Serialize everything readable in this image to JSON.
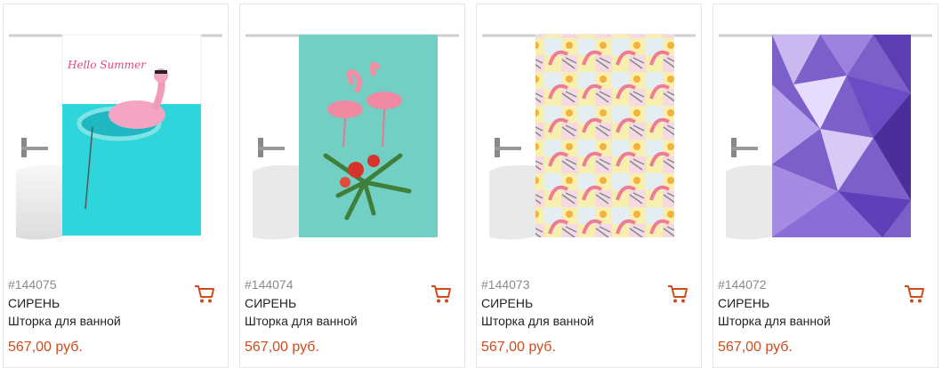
{
  "products": [
    {
      "sku": "#144075",
      "brand": "СИРЕНЬ",
      "title": "Шторка для ванной",
      "price": "567,00 руб.",
      "design": "hello-summer-flamingo"
    },
    {
      "sku": "#144074",
      "brand": "СИРЕНЬ",
      "title": "Шторка для ванной",
      "price": "567,00 руб.",
      "design": "flamingos-on-teal"
    },
    {
      "sku": "#144073",
      "brand": "СИРЕНЬ",
      "title": "Шторка для ванной",
      "price": "567,00 руб.",
      "design": "flamingo-tropical-pattern"
    },
    {
      "sku": "#144072",
      "brand": "СИРЕНЬ",
      "title": "Шторка для ванной",
      "price": "567,00 руб.",
      "design": "purple-polygons"
    }
  ],
  "curtain_print_text": "Hello Summer",
  "colors": {
    "price": "#cf4b1c",
    "cart_icon": "#cf4b1c",
    "sku": "#8a8a8a"
  },
  "icons": {
    "cart": "shopping-cart-icon"
  }
}
